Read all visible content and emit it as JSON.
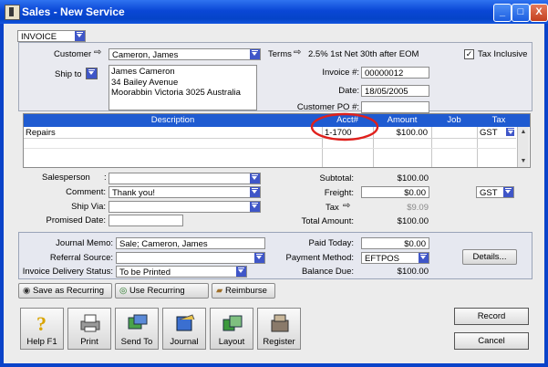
{
  "window": {
    "title": "Sales - New Service",
    "minimize": "_",
    "maximize": "□",
    "close": "X"
  },
  "layout_select": {
    "value": "INVOICE"
  },
  "customer": {
    "label": "Customer",
    "value": "Cameron, James"
  },
  "terms": {
    "label": "Terms",
    "value": "2.5% 1st Net 30th after EOM"
  },
  "tax_inclusive": {
    "label": "Tax Inclusive",
    "checked": "✓"
  },
  "ship_to": {
    "label": "Ship to",
    "address": [
      "James Cameron",
      "34 Bailey Avenue",
      "Moorabbin  Victoria  3025  Australia"
    ]
  },
  "invoice_number": {
    "label": "Invoice #:",
    "value": "00000012"
  },
  "date": {
    "label": "Date:",
    "value": "18/05/2005"
  },
  "customer_po": {
    "label": "Customer PO #:",
    "value": ""
  },
  "grid": {
    "columns": [
      "Description",
      "Acct#",
      "Amount",
      "Job",
      "Tax"
    ],
    "rows": [
      {
        "description": "Repairs",
        "acct": "1-1700",
        "amount": "$100.00",
        "job": "",
        "tax": "GST"
      }
    ]
  },
  "salesperson": {
    "label": "Salesperson",
    "value": ""
  },
  "comment": {
    "label": "Comment:",
    "value": "Thank you!"
  },
  "ship_via": {
    "label": "Ship Via:",
    "value": ""
  },
  "promised_date": {
    "label": "Promised Date:",
    "value": ""
  },
  "totals": {
    "subtotal_label": "Subtotal:",
    "subtotal": "$100.00",
    "freight_label": "Freight:",
    "freight": "$0.00",
    "freight_tax": "GST",
    "tax_label": "Tax",
    "tax": "$9.09",
    "total_label": "Total Amount:",
    "total": "$100.00"
  },
  "journal_memo": {
    "label": "Journal Memo:",
    "value": "Sale; Cameron, James"
  },
  "referral_source": {
    "label": "Referral Source:",
    "value": ""
  },
  "invoice_delivery": {
    "label": "Invoice Delivery Status:",
    "value": "To be Printed"
  },
  "paid_today": {
    "label": "Paid Today:",
    "value": "$0.00"
  },
  "payment_method": {
    "label": "Payment Method:",
    "value": "EFTPOS"
  },
  "balance_due": {
    "label": "Balance Due:",
    "value": "$100.00"
  },
  "details_button": "Details...",
  "actions": {
    "save_recurring": "Save as Recurring",
    "use_recurring": "Use Recurring",
    "reimburse": "Reimburse"
  },
  "toolbar": {
    "help": "Help F1",
    "print": "Print",
    "send_to": "Send To",
    "journal": "Journal",
    "layout": "Layout",
    "register": "Register"
  },
  "record_button": "Record",
  "cancel_button": "Cancel",
  "colors": {
    "title_blue": "#0a47d6",
    "grid_header": "#1f5bd1",
    "highlight_circle": "#e0201c"
  }
}
